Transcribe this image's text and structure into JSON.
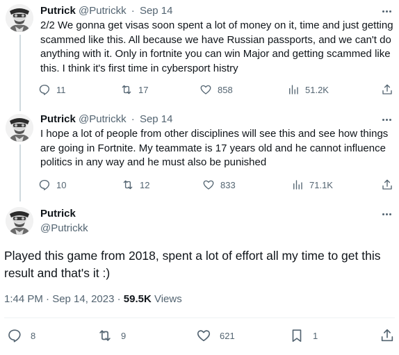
{
  "tweets": [
    {
      "name": "Putrick",
      "handle": "@Putrickk",
      "time": "Sep 14",
      "text": "2/2 We gonna get visas soon spent a lot of money on it, time and just getting scammed like this. All because we have Russian passports, and we can't do anything with it. Only in fortnite you can win Major and getting scammed like this. I think it's first time in cybersport histry",
      "replies": "11",
      "retweets": "17",
      "likes": "858",
      "views": "51.2K"
    },
    {
      "name": "Putrick",
      "handle": "@Putrickk",
      "time": "Sep 14",
      "text": "I hope a lot of people from other disciplines will see this and see how things are going in Fortnite. My teammate is 17 years old and he cannot influence politics in any way and he must also be punished",
      "replies": "10",
      "retweets": "12",
      "likes": "833",
      "views": "71.1K"
    }
  ],
  "main": {
    "name": "Putrick",
    "handle": "@Putrickk",
    "text": "Played this game from 2018, spent a lot of effort all my time to get this result and that's it :)",
    "timestamp": "1:44 PM · Sep 14, 2023 · ",
    "views_count": "59.5K",
    "views_label": "Views",
    "replies": "8",
    "retweets": "9",
    "likes": "621",
    "bookmarks": "1"
  },
  "colors": {
    "text": "#0f1419",
    "secondary": "#536471",
    "line": "#cfd9de"
  },
  "icons": [
    "reply-icon",
    "retweet-icon",
    "like-icon",
    "views-icon",
    "share-icon",
    "bookmark-icon",
    "more-icon"
  ]
}
